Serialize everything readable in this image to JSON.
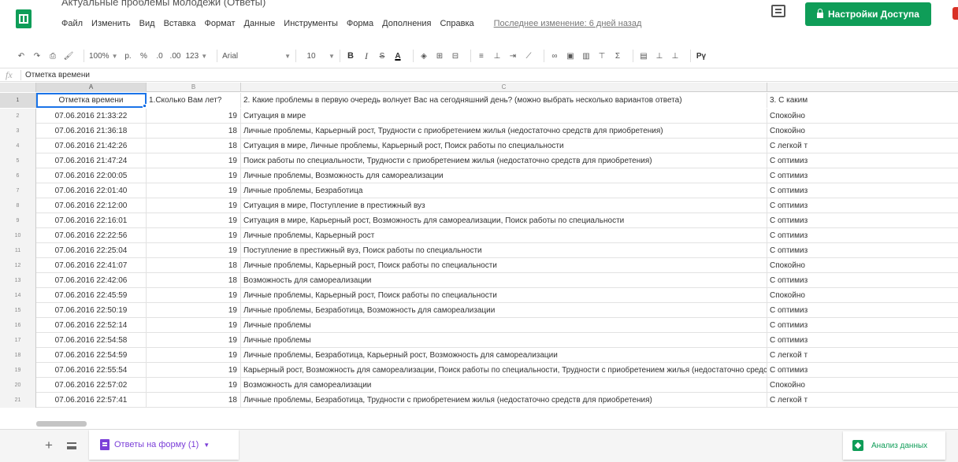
{
  "header": {
    "title": "Актуальные проблемы молодежи (Ответы)",
    "menu": [
      "Файл",
      "Изменить",
      "Вид",
      "Вставка",
      "Формат",
      "Данные",
      "Инструменты",
      "Форма",
      "Дополнения",
      "Справка"
    ],
    "last_edit": "Последнее изменение: 6 дней назад",
    "share_label": "Настройки Доступа"
  },
  "toolbar": {
    "zoom": "100%",
    "currency": "р.",
    "percent": "%",
    "decimal_decrease": ".0",
    "decimal_increase": ".00",
    "number_format": "123",
    "font": "Arial",
    "font_size": "10",
    "bold": "B",
    "italic": "I",
    "strike": "S",
    "text_color": "A",
    "input_tools": "Рү"
  },
  "formula_bar": {
    "fx": "fx",
    "value": "Отметка времени"
  },
  "columns": [
    "A",
    "B",
    "C",
    ""
  ],
  "header_row": {
    "num": "1",
    "a": "Отметка времени",
    "b": "1.Сколько Вам лет?",
    "c": "2. Какие проблемы в первую очередь волнует Вас на сегодняшний день? (можно выбрать несколько вариантов ответа)",
    "d": "3. С каким"
  },
  "rows": [
    {
      "num": "2",
      "a": "07.06.2016 21:33:22",
      "b": "19",
      "c": "Ситуация в мире",
      "d": "Спокойно"
    },
    {
      "num": "3",
      "a": "07.06.2016 21:36:18",
      "b": "18",
      "c": "Личные проблемы, Карьерный рост, Трудности с приобретением жилья (недостаточно средств для приобретения)",
      "d": "Спокойно"
    },
    {
      "num": "4",
      "a": "07.06.2016 21:42:26",
      "b": "18",
      "c": "Ситуация в мире, Личные проблемы, Карьерный рост, Поиск работы по специальности",
      "d": "С легкой т"
    },
    {
      "num": "5",
      "a": "07.06.2016 21:47:24",
      "b": "19",
      "c": "Поиск работы по специальности, Трудности с приобретением жилья (недостаточно средств для приобретения)",
      "d": "С оптимиз"
    },
    {
      "num": "6",
      "a": "07.06.2016 22:00:05",
      "b": "19",
      "c": "Личные проблемы, Возможность для самореализации",
      "d": "С оптимиз"
    },
    {
      "num": "7",
      "a": "07.06.2016 22:01:40",
      "b": "19",
      "c": "Личные проблемы, Безработица",
      "d": "С оптимиз"
    },
    {
      "num": "8",
      "a": "07.06.2016 22:12:00",
      "b": "19",
      "c": "Ситуация в мире, Поступление в престижный вуз",
      "d": "С оптимиз"
    },
    {
      "num": "9",
      "a": "07.06.2016 22:16:01",
      "b": "19",
      "c": "Ситуация в мире, Карьерный рост, Возможность для самореализации, Поиск работы по специальности",
      "d": "С оптимиз"
    },
    {
      "num": "10",
      "a": "07.06.2016 22:22:56",
      "b": "19",
      "c": "Личные проблемы, Карьерный рост",
      "d": "С оптимиз"
    },
    {
      "num": "11",
      "a": "07.06.2016 22:25:04",
      "b": "19",
      "c": "Поступление в престижный вуз, Поиск работы по специальности",
      "d": "С оптимиз"
    },
    {
      "num": "12",
      "a": "07.06.2016 22:41:07",
      "b": "18",
      "c": "Личные проблемы, Карьерный рост, Поиск работы по специальности",
      "d": "Спокойно"
    },
    {
      "num": "13",
      "a": "07.06.2016 22:42:06",
      "b": "18",
      "c": "Возможность для самореализации",
      "d": "С оптимиз"
    },
    {
      "num": "14",
      "a": "07.06.2016 22:45:59",
      "b": "19",
      "c": "Личные проблемы, Карьерный рост, Поиск работы по специальности",
      "d": "Спокойно"
    },
    {
      "num": "15",
      "a": "07.06.2016 22:50:19",
      "b": "19",
      "c": "Личные проблемы, Безработица, Возможность для самореализации",
      "d": "С оптимиз"
    },
    {
      "num": "16",
      "a": "07.06.2016 22:52:14",
      "b": "19",
      "c": "Личные проблемы",
      "d": "С оптимиз"
    },
    {
      "num": "17",
      "a": "07.06.2016 22:54:58",
      "b": "19",
      "c": "Личные проблемы",
      "d": "С оптимиз"
    },
    {
      "num": "18",
      "a": "07.06.2016 22:54:59",
      "b": "19",
      "c": "Личные проблемы, Безработица, Карьерный рост, Возможность для самореализации",
      "d": "С легкой т"
    },
    {
      "num": "19",
      "a": "07.06.2016 22:55:54",
      "b": "19",
      "c": "Карьерный рост, Возможность для самореализации, Поиск работы по специальности, Трудности с приобретением жилья (недостаточно средств для",
      "d": "С оптимиз"
    },
    {
      "num": "20",
      "a": "07.06.2016 22:57:02",
      "b": "19",
      "c": "Возможность для самореализации",
      "d": "Спокойно"
    },
    {
      "num": "21",
      "a": "07.06.2016 22:57:41",
      "b": "18",
      "c": "Личные проблемы, Безработица, Трудности с приобретением жилья (недостаточно средств для приобретения)",
      "d": "С легкой т"
    }
  ],
  "sheet_tab": {
    "label": "Ответы на форму (1)"
  },
  "explore": {
    "label": "Анализ данных"
  },
  "colors": {
    "brand_green": "#0f9d58",
    "selection_blue": "#1a73e8",
    "sheet_purple": "#7b3fd8"
  }
}
